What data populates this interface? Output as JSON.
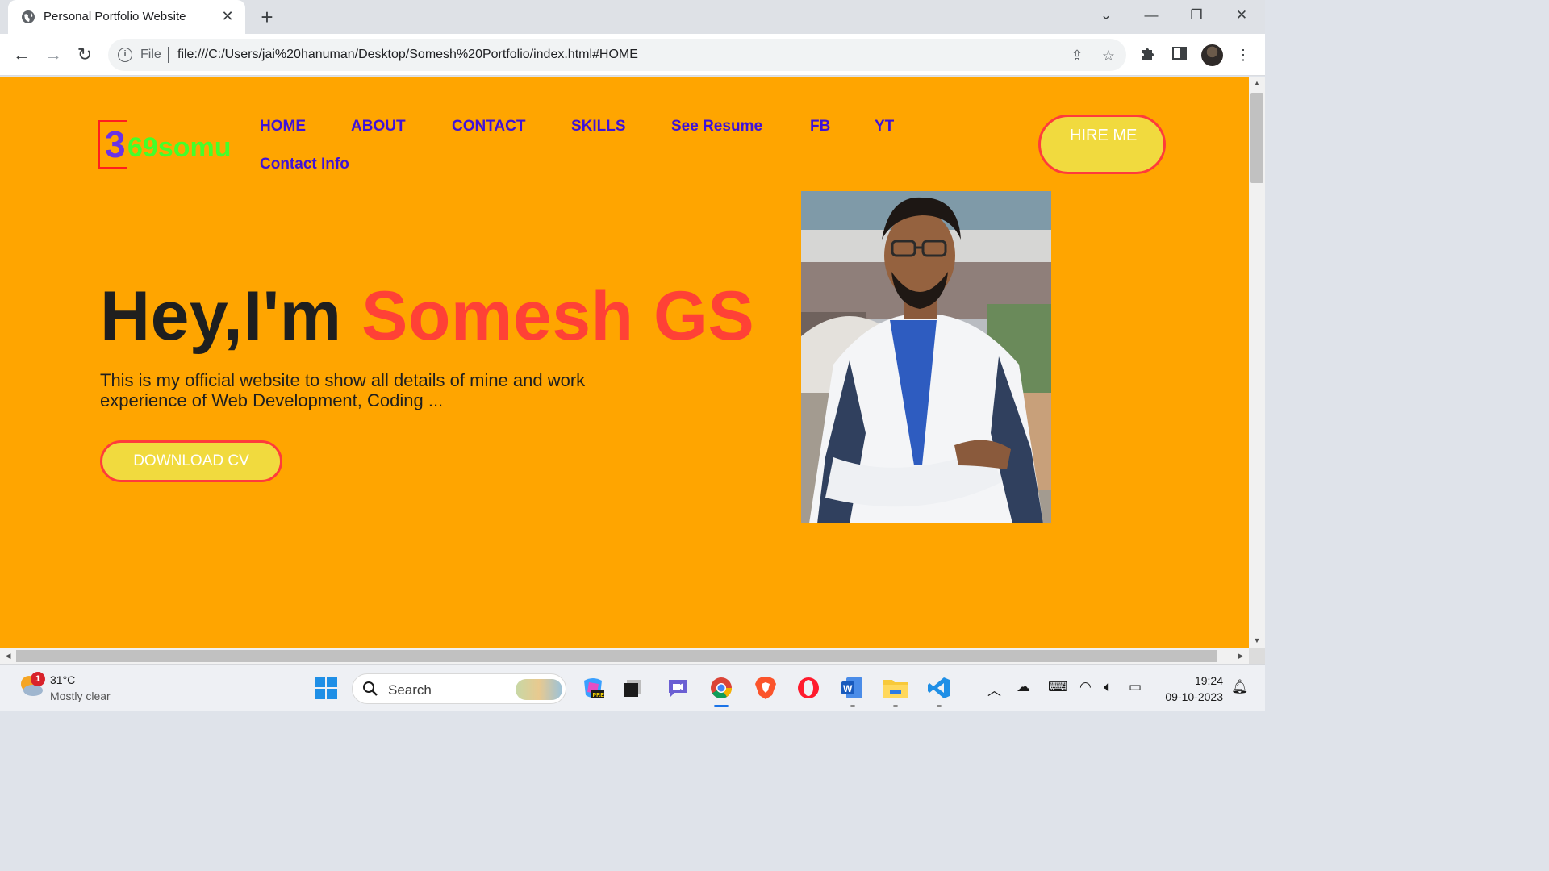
{
  "browser": {
    "tab_title": "Personal Portfolio Website",
    "tab_close": "✕",
    "new_tab": "+",
    "scheme": "File",
    "url": "file:///C:/Users/jai%20hanuman/Desktop/Somesh%20Portfolio/index.html#HOME",
    "window_controls": [
      "⌄",
      "—",
      "❐",
      "✕"
    ]
  },
  "page": {
    "logo": {
      "digit": "3",
      "rest": "69somu"
    },
    "nav": [
      "HOME",
      "ABOUT",
      "CONTACT",
      "SKILLS",
      "See Resume",
      "FB",
      "YT",
      "Contact Info"
    ],
    "hire_label": "HIRE ME",
    "hero": {
      "greeting": "Hey,I'm",
      "name": "Somesh GS",
      "description": "This is my official website to show all details of mine and work experience of Web Development, Coding ...",
      "download_label": "DOWNLOAD CV"
    },
    "colors": {
      "background": "#ffa500",
      "nav_text": "#3f12d8",
      "name": "#ff4136",
      "button_fill": "#f1da3e",
      "button_border": "#ff3b3b",
      "logo_digit": "#6a32e6",
      "logo_text": "#44ff2a"
    }
  },
  "taskbar": {
    "weather_badge": "1",
    "temperature": "31°C",
    "condition": "Mostly clear",
    "search_label": "Search",
    "time": "19:24",
    "date": "09-10-2023",
    "apps": [
      "windows-start-icon",
      "copilot-pre-icon",
      "task-view-icon",
      "teams-chat-icon",
      "chrome-icon",
      "brave-icon",
      "opera-icon",
      "word-icon",
      "file-explorer-icon",
      "vscode-icon"
    ],
    "tray": [
      "chevron-up-icon",
      "onedrive-icon",
      "keyboard-icon",
      "wifi-icon",
      "volume-icon",
      "battery-icon"
    ]
  }
}
